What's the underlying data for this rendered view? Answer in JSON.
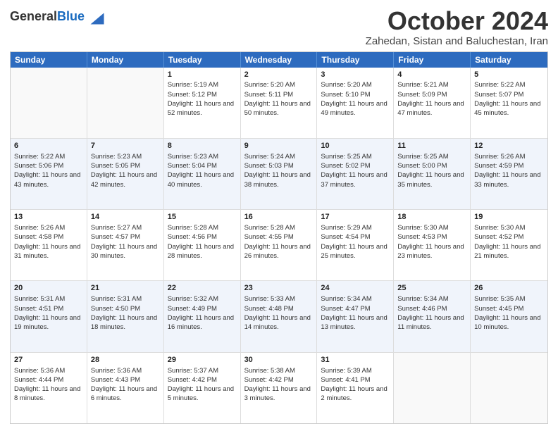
{
  "header": {
    "logo_general": "General",
    "logo_blue": "Blue",
    "month": "October 2024",
    "location": "Zahedan, Sistan and Baluchestan, Iran"
  },
  "days_of_week": [
    "Sunday",
    "Monday",
    "Tuesday",
    "Wednesday",
    "Thursday",
    "Friday",
    "Saturday"
  ],
  "weeks": [
    [
      {
        "day": "",
        "sunrise": "",
        "sunset": "",
        "daylight": "",
        "empty": true
      },
      {
        "day": "",
        "sunrise": "",
        "sunset": "",
        "daylight": "",
        "empty": true
      },
      {
        "day": "1",
        "sunrise": "Sunrise: 5:19 AM",
        "sunset": "Sunset: 5:12 PM",
        "daylight": "Daylight: 11 hours and 52 minutes."
      },
      {
        "day": "2",
        "sunrise": "Sunrise: 5:20 AM",
        "sunset": "Sunset: 5:11 PM",
        "daylight": "Daylight: 11 hours and 50 minutes."
      },
      {
        "day": "3",
        "sunrise": "Sunrise: 5:20 AM",
        "sunset": "Sunset: 5:10 PM",
        "daylight": "Daylight: 11 hours and 49 minutes."
      },
      {
        "day": "4",
        "sunrise": "Sunrise: 5:21 AM",
        "sunset": "Sunset: 5:09 PM",
        "daylight": "Daylight: 11 hours and 47 minutes."
      },
      {
        "day": "5",
        "sunrise": "Sunrise: 5:22 AM",
        "sunset": "Sunset: 5:07 PM",
        "daylight": "Daylight: 11 hours and 45 minutes."
      }
    ],
    [
      {
        "day": "6",
        "sunrise": "Sunrise: 5:22 AM",
        "sunset": "Sunset: 5:06 PM",
        "daylight": "Daylight: 11 hours and 43 minutes."
      },
      {
        "day": "7",
        "sunrise": "Sunrise: 5:23 AM",
        "sunset": "Sunset: 5:05 PM",
        "daylight": "Daylight: 11 hours and 42 minutes."
      },
      {
        "day": "8",
        "sunrise": "Sunrise: 5:23 AM",
        "sunset": "Sunset: 5:04 PM",
        "daylight": "Daylight: 11 hours and 40 minutes."
      },
      {
        "day": "9",
        "sunrise": "Sunrise: 5:24 AM",
        "sunset": "Sunset: 5:03 PM",
        "daylight": "Daylight: 11 hours and 38 minutes."
      },
      {
        "day": "10",
        "sunrise": "Sunrise: 5:25 AM",
        "sunset": "Sunset: 5:02 PM",
        "daylight": "Daylight: 11 hours and 37 minutes."
      },
      {
        "day": "11",
        "sunrise": "Sunrise: 5:25 AM",
        "sunset": "Sunset: 5:00 PM",
        "daylight": "Daylight: 11 hours and 35 minutes."
      },
      {
        "day": "12",
        "sunrise": "Sunrise: 5:26 AM",
        "sunset": "Sunset: 4:59 PM",
        "daylight": "Daylight: 11 hours and 33 minutes."
      }
    ],
    [
      {
        "day": "13",
        "sunrise": "Sunrise: 5:26 AM",
        "sunset": "Sunset: 4:58 PM",
        "daylight": "Daylight: 11 hours and 31 minutes."
      },
      {
        "day": "14",
        "sunrise": "Sunrise: 5:27 AM",
        "sunset": "Sunset: 4:57 PM",
        "daylight": "Daylight: 11 hours and 30 minutes."
      },
      {
        "day": "15",
        "sunrise": "Sunrise: 5:28 AM",
        "sunset": "Sunset: 4:56 PM",
        "daylight": "Daylight: 11 hours and 28 minutes."
      },
      {
        "day": "16",
        "sunrise": "Sunrise: 5:28 AM",
        "sunset": "Sunset: 4:55 PM",
        "daylight": "Daylight: 11 hours and 26 minutes."
      },
      {
        "day": "17",
        "sunrise": "Sunrise: 5:29 AM",
        "sunset": "Sunset: 4:54 PM",
        "daylight": "Daylight: 11 hours and 25 minutes."
      },
      {
        "day": "18",
        "sunrise": "Sunrise: 5:30 AM",
        "sunset": "Sunset: 4:53 PM",
        "daylight": "Daylight: 11 hours and 23 minutes."
      },
      {
        "day": "19",
        "sunrise": "Sunrise: 5:30 AM",
        "sunset": "Sunset: 4:52 PM",
        "daylight": "Daylight: 11 hours and 21 minutes."
      }
    ],
    [
      {
        "day": "20",
        "sunrise": "Sunrise: 5:31 AM",
        "sunset": "Sunset: 4:51 PM",
        "daylight": "Daylight: 11 hours and 19 minutes."
      },
      {
        "day": "21",
        "sunrise": "Sunrise: 5:31 AM",
        "sunset": "Sunset: 4:50 PM",
        "daylight": "Daylight: 11 hours and 18 minutes."
      },
      {
        "day": "22",
        "sunrise": "Sunrise: 5:32 AM",
        "sunset": "Sunset: 4:49 PM",
        "daylight": "Daylight: 11 hours and 16 minutes."
      },
      {
        "day": "23",
        "sunrise": "Sunrise: 5:33 AM",
        "sunset": "Sunset: 4:48 PM",
        "daylight": "Daylight: 11 hours and 14 minutes."
      },
      {
        "day": "24",
        "sunrise": "Sunrise: 5:34 AM",
        "sunset": "Sunset: 4:47 PM",
        "daylight": "Daylight: 11 hours and 13 minutes."
      },
      {
        "day": "25",
        "sunrise": "Sunrise: 5:34 AM",
        "sunset": "Sunset: 4:46 PM",
        "daylight": "Daylight: 11 hours and 11 minutes."
      },
      {
        "day": "26",
        "sunrise": "Sunrise: 5:35 AM",
        "sunset": "Sunset: 4:45 PM",
        "daylight": "Daylight: 11 hours and 10 minutes."
      }
    ],
    [
      {
        "day": "27",
        "sunrise": "Sunrise: 5:36 AM",
        "sunset": "Sunset: 4:44 PM",
        "daylight": "Daylight: 11 hours and 8 minutes."
      },
      {
        "day": "28",
        "sunrise": "Sunrise: 5:36 AM",
        "sunset": "Sunset: 4:43 PM",
        "daylight": "Daylight: 11 hours and 6 minutes."
      },
      {
        "day": "29",
        "sunrise": "Sunrise: 5:37 AM",
        "sunset": "Sunset: 4:42 PM",
        "daylight": "Daylight: 11 hours and 5 minutes."
      },
      {
        "day": "30",
        "sunrise": "Sunrise: 5:38 AM",
        "sunset": "Sunset: 4:42 PM",
        "daylight": "Daylight: 11 hours and 3 minutes."
      },
      {
        "day": "31",
        "sunrise": "Sunrise: 5:39 AM",
        "sunset": "Sunset: 4:41 PM",
        "daylight": "Daylight: 11 hours and 2 minutes."
      },
      {
        "day": "",
        "sunrise": "",
        "sunset": "",
        "daylight": "",
        "empty": true
      },
      {
        "day": "",
        "sunrise": "",
        "sunset": "",
        "daylight": "",
        "empty": true
      }
    ]
  ]
}
